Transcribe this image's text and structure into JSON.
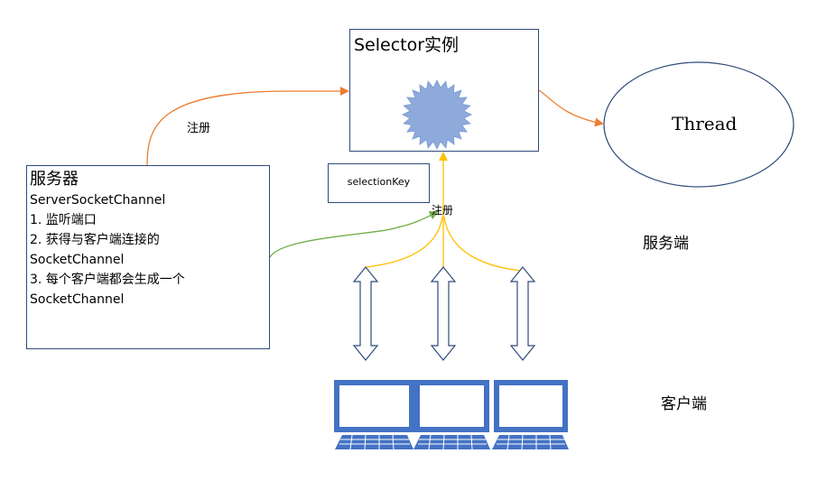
{
  "selector": {
    "title": "Selector实例"
  },
  "thread": {
    "label": "Thread"
  },
  "selection_key": {
    "label": "selectionKey"
  },
  "server": {
    "title": "服务器",
    "lines": [
      "ServerSocketChannel",
      "1. 监听端口",
      "2. 获得与客户端连接的",
      "SocketChannel",
      "3. 每个客户端都会生成一个",
      "SocketChannel"
    ]
  },
  "edges": {
    "server_register": "注册",
    "client_register": "注册"
  },
  "sides": {
    "server": "服务端",
    "client": "客户端"
  },
  "colors": {
    "box_border": "#2f4b7c",
    "star_fill": "#8eaadb",
    "orange_arrow": "#ed7d31",
    "green_arrow": "#70ad47",
    "yellow_line": "#ffc000",
    "monitor_blue": "#4472c4"
  }
}
